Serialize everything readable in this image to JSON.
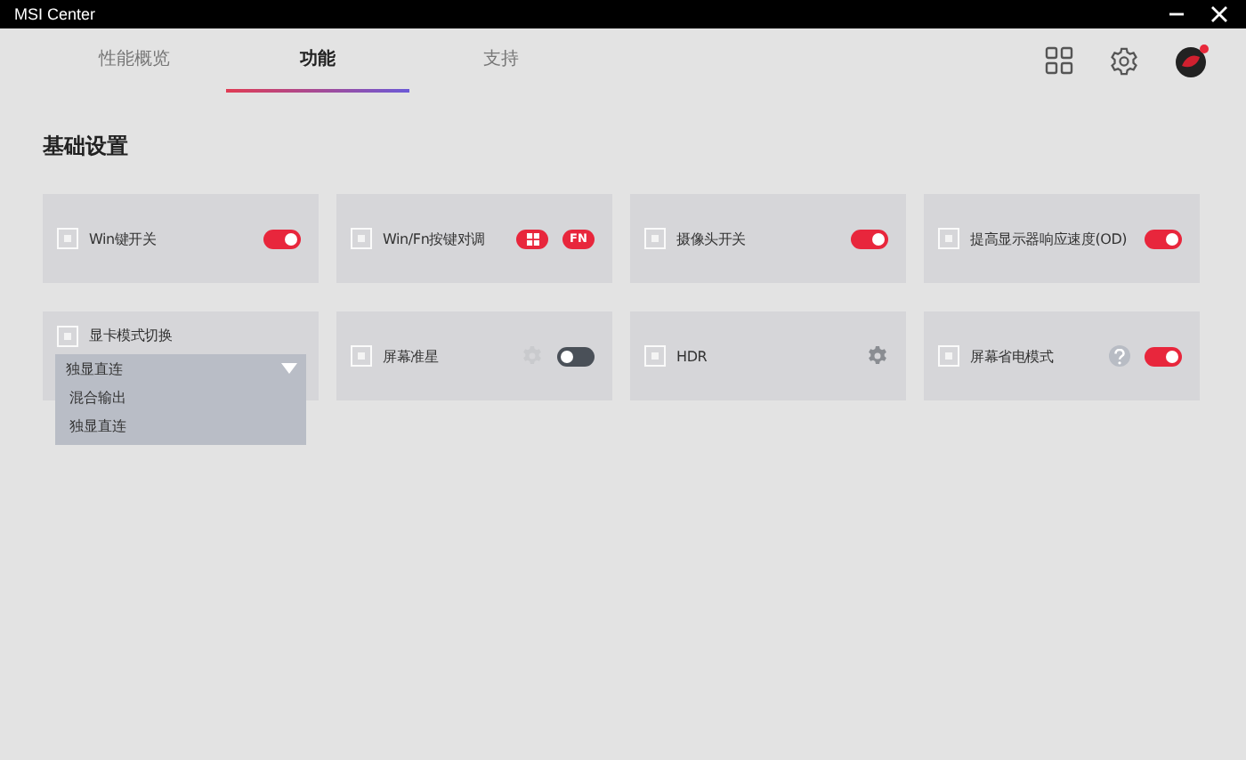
{
  "window": {
    "title": "MSI Center"
  },
  "tabs": [
    {
      "label": "性能概览",
      "selected": false
    },
    {
      "label": "功能",
      "selected": true
    },
    {
      "label": "支持",
      "selected": false
    }
  ],
  "section_title": "基础设置",
  "rows": [
    [
      {
        "label": "Win键开关",
        "controls": [
          {
            "kind": "toggle",
            "on": true
          }
        ]
      },
      {
        "label": "Win/Fn按键对调",
        "controls": [
          {
            "kind": "win-chip"
          },
          {
            "kind": "text-chip",
            "text": "FN"
          }
        ]
      },
      {
        "label": "摄像头开关",
        "controls": [
          {
            "kind": "toggle",
            "on": true
          }
        ]
      },
      {
        "label": "提高显示器响应速度(OD)",
        "controls": [
          {
            "kind": "toggle",
            "on": true
          }
        ]
      }
    ],
    [
      {
        "label": "显卡模式切换",
        "dropdown": {
          "value": "独显直连",
          "expanded": true,
          "options": [
            "混合输出",
            "独显直连"
          ]
        }
      },
      {
        "label": "屏幕准星",
        "controls": [
          {
            "kind": "gear",
            "disabled": true
          },
          {
            "kind": "toggle",
            "on": false
          }
        ]
      },
      {
        "label": "HDR",
        "controls": [
          {
            "kind": "gear",
            "disabled": false
          }
        ]
      },
      {
        "label": "屏幕省电模式",
        "controls": [
          {
            "kind": "help"
          },
          {
            "kind": "toggle",
            "on": true
          }
        ]
      }
    ]
  ]
}
